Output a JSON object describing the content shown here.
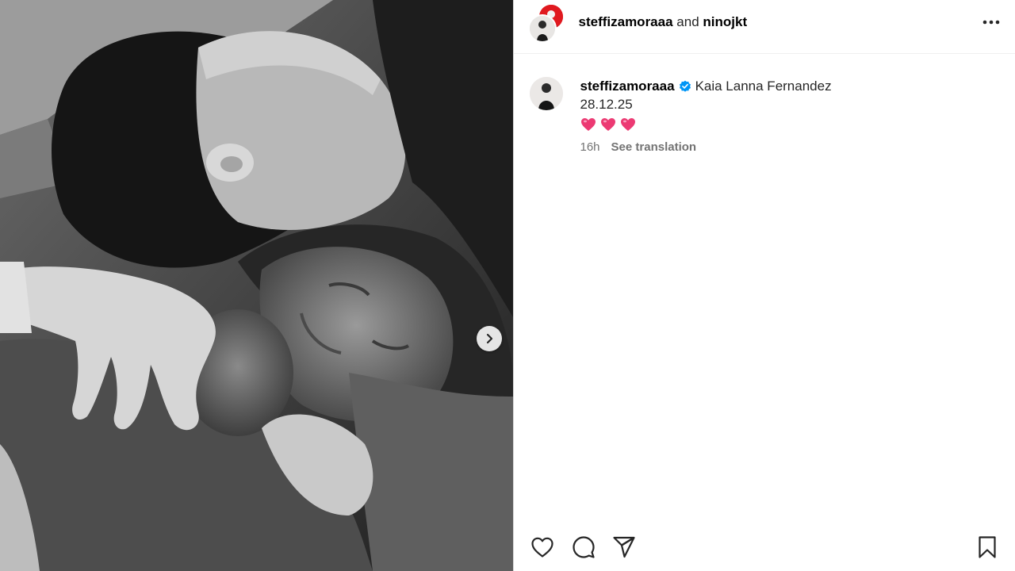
{
  "media": {
    "next_icon": "chevron-right-icon"
  },
  "header": {
    "collab_user_1": "steffizamoraaa",
    "and_text": "and",
    "collab_user_2": "ninojkt",
    "more_icon": "more-horizontal-icon"
  },
  "caption": {
    "username": "steffizamoraaa",
    "verified_icon": "verified-badge-icon",
    "text": "Kaia Lanna Fernandez",
    "date": "28.12.25",
    "emoji": [
      "heart",
      "heart",
      "heart"
    ],
    "emoji_color": "#ec3a73",
    "time_ago": "16h",
    "see_translation": "See translation"
  },
  "actions": {
    "like_icon": "heart-outline-icon",
    "comment_icon": "comment-icon",
    "share_icon": "share-icon",
    "save_icon": "bookmark-icon"
  },
  "colors": {
    "verified_blue": "#0095f6",
    "collab_avatar_red": "#e0191f",
    "secondary_text": "#737373"
  }
}
